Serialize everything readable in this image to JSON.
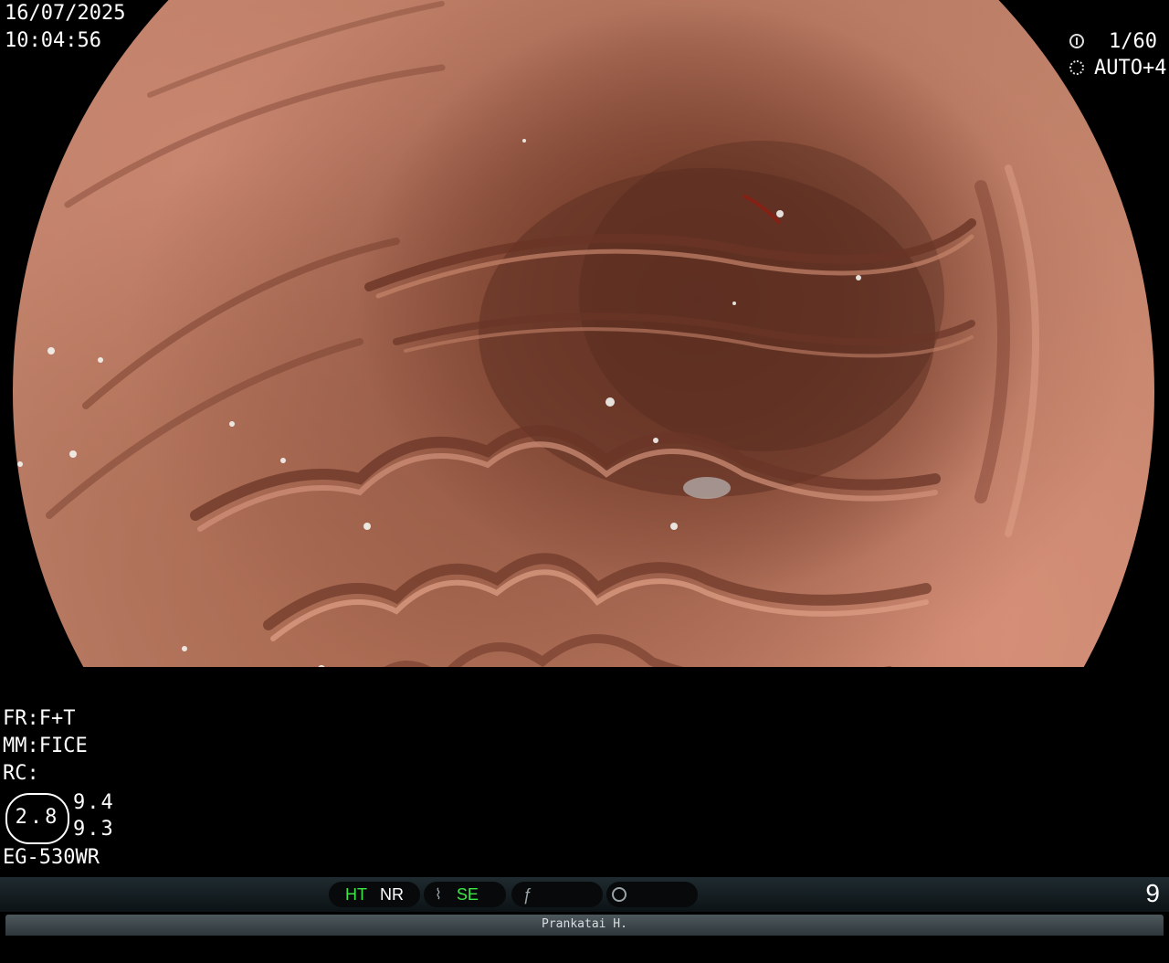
{
  "overlay": {
    "date": "16/07/2025",
    "time": "10:04:56",
    "shutter_speed": "1/60",
    "iris_mode": "AUTO+4",
    "fr_mode": "FR:F+T",
    "mm_mode": "MM:FICE",
    "rc_label": "RC:",
    "ring_value": "2.8",
    "value_a": "9.4",
    "value_b": "9.3",
    "scope_model": "EG-530WR"
  },
  "status_bar": {
    "ht": "HT",
    "nr": "NR",
    "se": "SE",
    "index": "9"
  },
  "footer": {
    "operator": "Prankatai H."
  },
  "icons": [
    "aperture-icon",
    "gear-ring-icon",
    "signal-icon",
    "function-icon",
    "camera-mode-icon"
  ]
}
